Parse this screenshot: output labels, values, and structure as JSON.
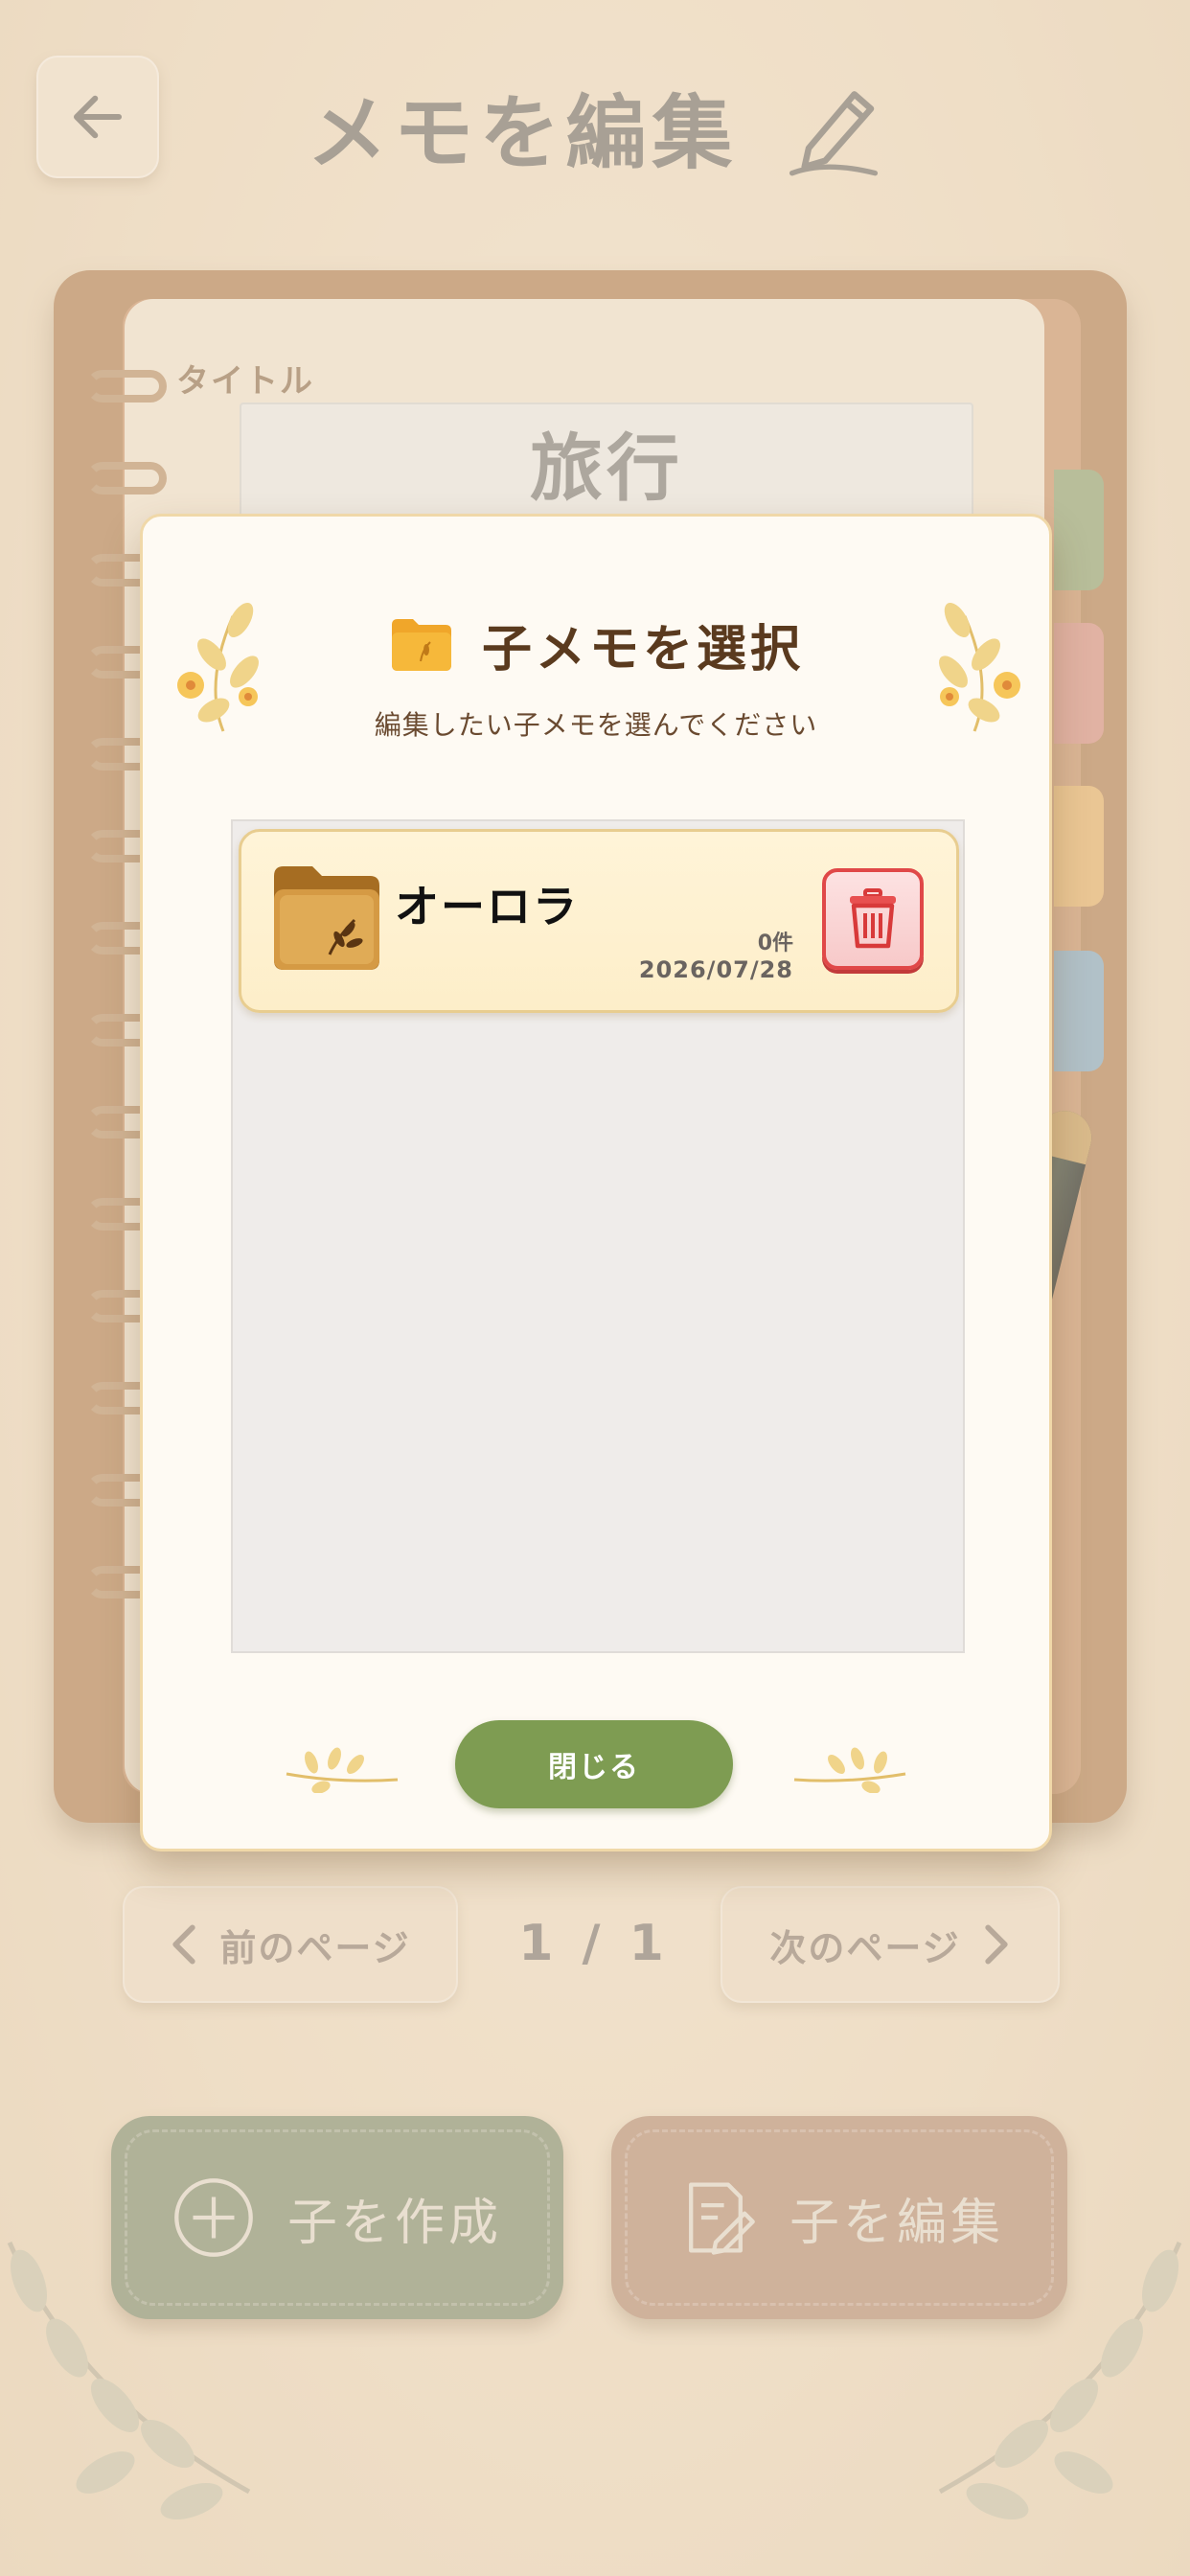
{
  "header": {
    "title": "メモを編集"
  },
  "memo_form": {
    "title_label": "タイトル",
    "title_value": "旅行"
  },
  "pagination": {
    "prev_label": "前のページ",
    "next_label": "次のページ",
    "indicator": "1 / 1"
  },
  "actions": {
    "create_child_label": "子を作成",
    "edit_child_label": "子を編集"
  },
  "modal": {
    "title": "子メモを選択",
    "subtitle": "編集したい子メモを選んでください",
    "items": [
      {
        "name": "オーロラ",
        "count": "0件",
        "date": "2026/07/28"
      }
    ],
    "close_label": "閉じる"
  },
  "colors": {
    "background": "#efdcc2",
    "accent_green": "#7e9c52",
    "delete_red": "#e04848",
    "card_border": "#e8cd90",
    "title_brown": "#5a3a1e"
  }
}
